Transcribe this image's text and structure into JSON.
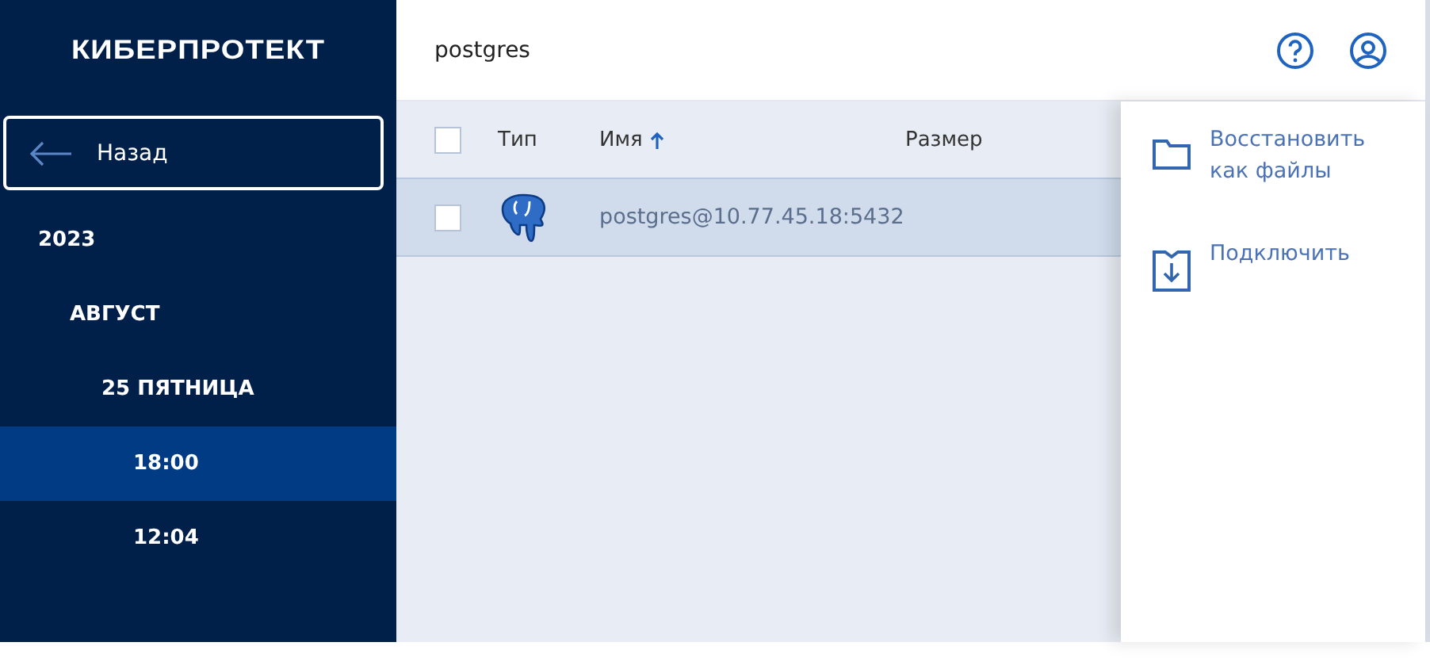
{
  "logo": "КИБЕРПРОТЕКТ",
  "back_button": {
    "label": "Назад"
  },
  "tree": [
    {
      "label": "2023",
      "selected": false,
      "children": [
        {
          "label": "АВГУСТ",
          "selected": false,
          "children": [
            {
              "label": "25 ПЯТНИЦА",
              "selected": false,
              "children": [
                {
                  "label": "18:00",
                  "selected": true
                },
                {
                  "label": "12:04",
                  "selected": false
                }
              ]
            }
          ]
        }
      ]
    }
  ],
  "header": {
    "title": "postgres"
  },
  "table": {
    "select_all": {
      "checked": false
    },
    "columns": [
      {
        "label": "Тип",
        "sorted": false
      },
      {
        "label": "Имя",
        "sorted": true
      },
      {
        "label": "Размер",
        "sorted": false
      }
    ],
    "rows": [
      {
        "checked": false,
        "selected": true,
        "name": "postgres@10.77.45.18:5432"
      }
    ]
  },
  "actions": [
    {
      "kind": "folder",
      "label": "Восстановить как файлы"
    },
    {
      "kind": "mount",
      "label": "Подключить"
    }
  ]
}
